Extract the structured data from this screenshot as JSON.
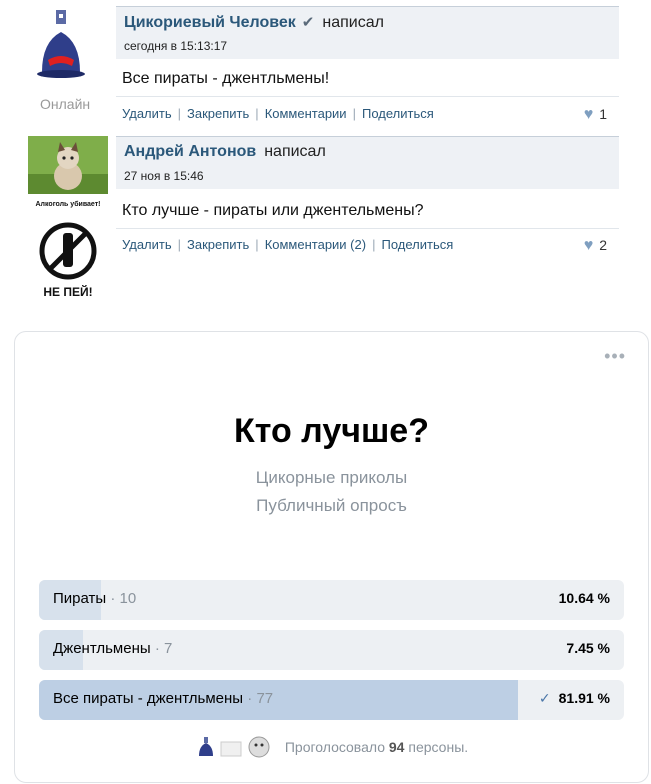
{
  "posts": [
    {
      "author": "Цикориевый Человек",
      "action": "написал",
      "time": "сегодня в 15:13:17",
      "text": "Все пираты - джентльмены!",
      "status": "Онлайн",
      "actions": [
        "Удалить",
        "Закрепить",
        "Комментарии",
        "Поделиться"
      ],
      "likes": "1"
    },
    {
      "author": "Андрей Антонов",
      "action": "написал",
      "time": "27 ноя в 15:46",
      "text": "Кто лучше - пираты или джентельмены?",
      "actions": [
        "Удалить",
        "Закрепить",
        "Комментарии (2)",
        "Поделиться"
      ],
      "likes": "2",
      "banner_caption": "Алкоголь убивает!",
      "banner_text": "НЕ ПЕЙ!"
    }
  ],
  "poll": {
    "title": "Кто лучше?",
    "source": "Цикорные приколы",
    "type": "Публичный опросъ",
    "options": [
      {
        "label": "Пираты",
        "count": "10",
        "percent": "10.64 %",
        "fraction": 0.1064,
        "selected": false
      },
      {
        "label": "Джентльмены",
        "count": "7",
        "percent": "7.45 %",
        "fraction": 0.0745,
        "selected": false
      },
      {
        "label": "Все пираты - джентльмены",
        "count": "77",
        "percent": "81.91 %",
        "fraction": 0.8191,
        "selected": true
      }
    ],
    "footer_prefix": "Проголосовало",
    "footer_count": "94",
    "footer_suffix": "персоны."
  },
  "colors": {
    "accent": "#2b587a",
    "bar_fill": "#d7e1ec",
    "bar_selected": "#bdcfe4"
  }
}
